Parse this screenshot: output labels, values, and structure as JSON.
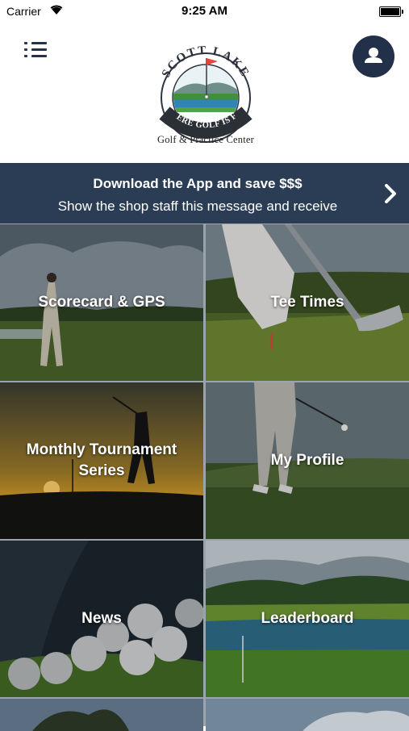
{
  "status_bar": {
    "carrier": "Carrier",
    "time": "9:25 AM",
    "wifi_icon": "wifi-icon",
    "battery_icon": "battery-icon"
  },
  "header": {
    "menu_icon": "list-menu-icon",
    "profile_icon": "user-icon",
    "logo": {
      "top_text": "SCOTT LAKE",
      "banner_text": "WHERE GOLF IS FUN",
      "subtitle": "Golf & Practice Center"
    }
  },
  "promo_banner": {
    "title": "Download the App and save $$$",
    "text": "Show the shop staff this message and receive",
    "chevron_icon": "chevron-right-icon"
  },
  "tiles": [
    {
      "label": "Scorecard & GPS"
    },
    {
      "label": "Tee Times"
    },
    {
      "label": "Monthly Tournament Series"
    },
    {
      "label": "My Profile"
    },
    {
      "label": "News"
    },
    {
      "label": "Leaderboard"
    }
  ],
  "colors": {
    "navy": "#223049",
    "banner": "#2a3d55",
    "logo_red": "#e8463c",
    "logo_green": "#3f8f3c",
    "logo_blue": "#2f86b5"
  }
}
